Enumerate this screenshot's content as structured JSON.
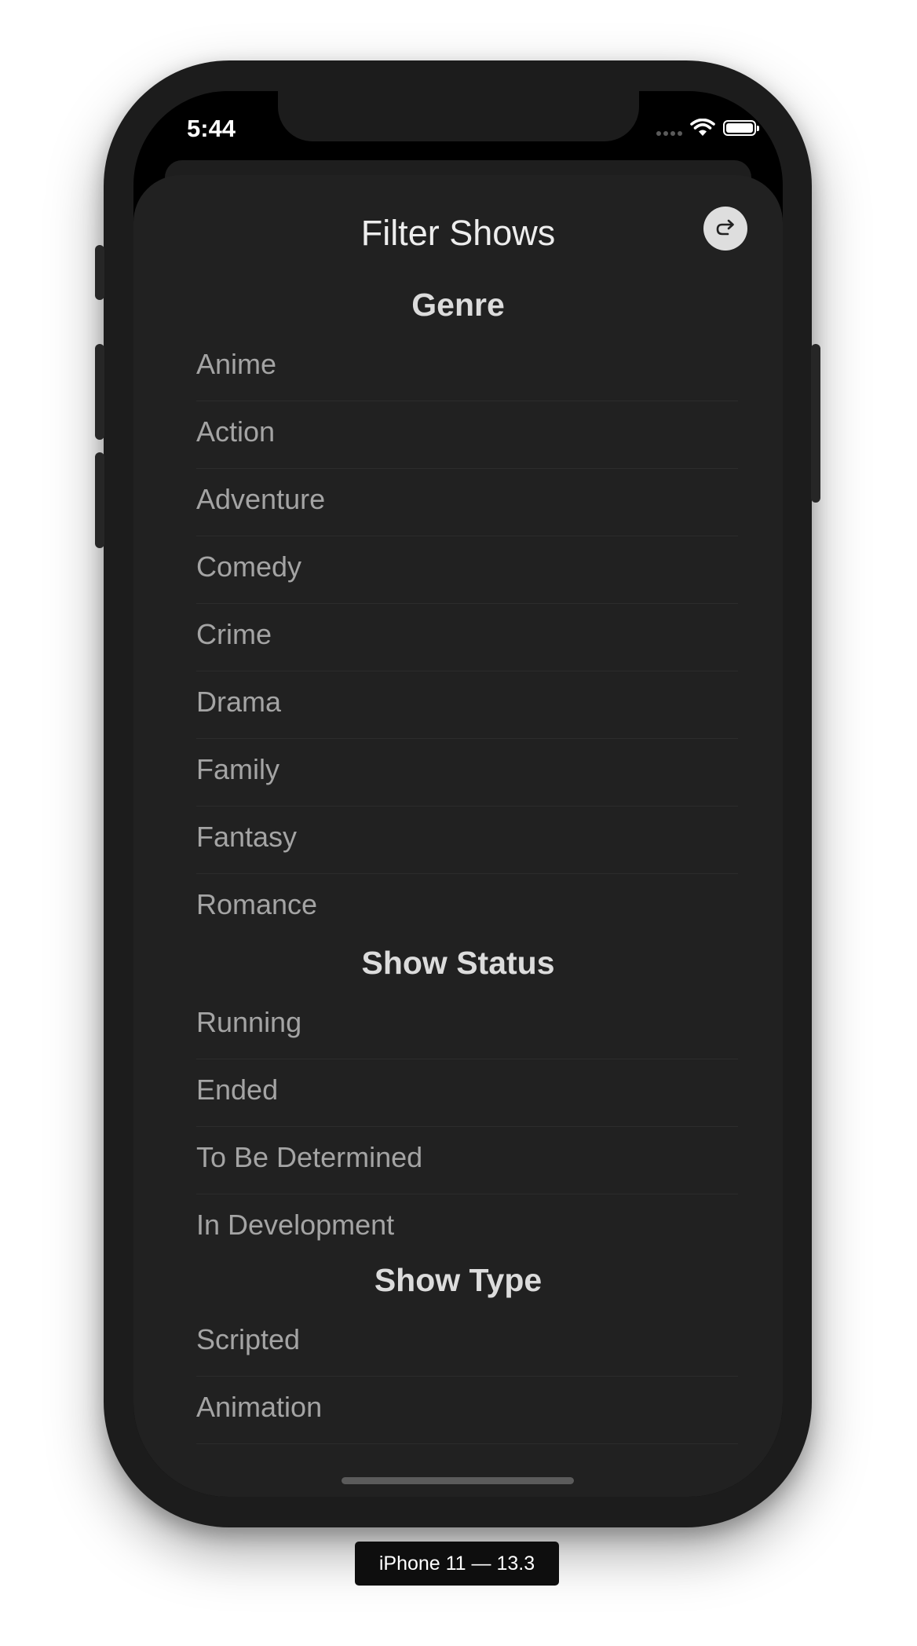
{
  "status_bar": {
    "time": "5:44"
  },
  "sheet": {
    "title": "Filter Shows",
    "reset_icon": "redo-arrow-icon"
  },
  "sections": [
    {
      "header": "Genre",
      "items": [
        "Anime",
        "Action",
        "Adventure",
        "Comedy",
        "Crime",
        "Drama",
        "Family",
        "Fantasy",
        "Romance"
      ]
    },
    {
      "header": "Show Status",
      "items": [
        "Running",
        "Ended",
        "To Be Determined",
        "In Development"
      ]
    },
    {
      "header": "Show Type",
      "items": [
        "Scripted",
        "Animation"
      ]
    }
  ],
  "device_label": "iPhone 11 — 13.3",
  "colors": {
    "sheet_background": "#212121",
    "phone_frame": "#1c1c1c",
    "row_text": "#a4a4a4",
    "header_text": "#dcdcdc"
  }
}
